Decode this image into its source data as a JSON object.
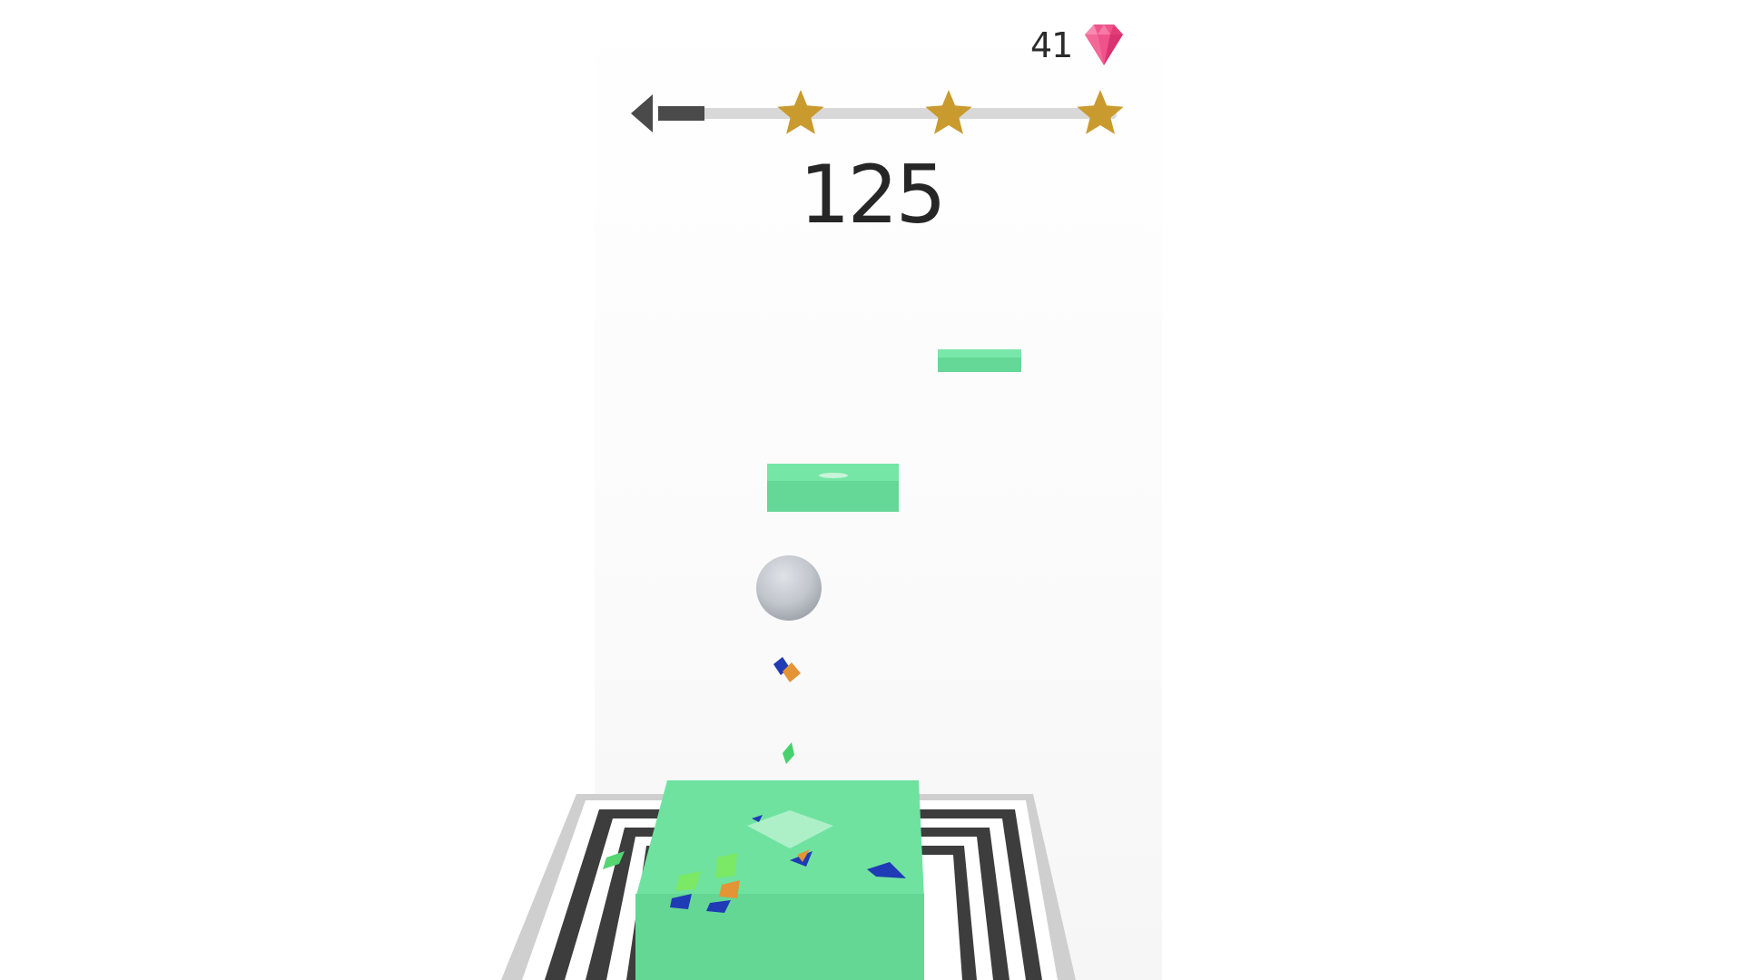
{
  "hud": {
    "gems": "41",
    "gem_icon": "pink-diamond-gem",
    "score": "125",
    "progress": {
      "back_icon": "left-arrow",
      "fraction_complete": 0.1,
      "stars": [
        "star",
        "star",
        "star"
      ],
      "star_color": "#c99a2e",
      "fill_color": "#4a4a4a",
      "track_color": "#d8d8d8"
    }
  },
  "scene": {
    "platform_color": "#6ee39f",
    "platform_side_color": "#5fd08e",
    "ball_color": "#c4c8cf",
    "frame_color": "#3d3d3d"
  }
}
